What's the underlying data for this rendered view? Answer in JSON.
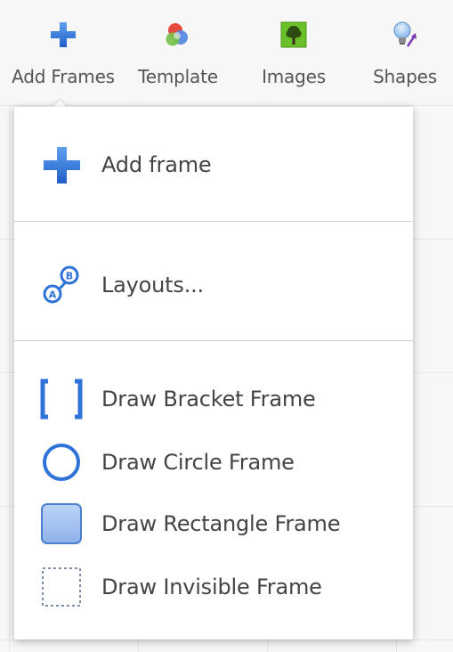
{
  "toolbar": {
    "items": [
      {
        "label": "Add Frames",
        "icon": "plus-icon"
      },
      {
        "label": "Template",
        "icon": "color-circles-icon"
      },
      {
        "label": "Images",
        "icon": "tree-image-icon"
      },
      {
        "label": "Shapes",
        "icon": "lightbulb-shapes-icon"
      }
    ]
  },
  "menu": {
    "sections": [
      {
        "items": [
          {
            "label": "Add frame",
            "icon": "plus-icon"
          }
        ]
      },
      {
        "items": [
          {
            "label": "Layouts...",
            "icon": "layouts-ab-icon"
          }
        ]
      },
      {
        "items": [
          {
            "label": "Draw Bracket Frame",
            "icon": "bracket-frame-icon"
          },
          {
            "label": "Draw Circle Frame",
            "icon": "circle-frame-icon"
          },
          {
            "label": "Draw Rectangle Frame",
            "icon": "rectangle-frame-icon"
          },
          {
            "label": "Draw Invisible Frame",
            "icon": "invisible-frame-icon"
          }
        ]
      }
    ]
  },
  "colors": {
    "accent_blue": "#2f73d9",
    "image_green": "#6bbf2a",
    "menu_bg": "#ffffff",
    "divider": "#cfcfcf"
  }
}
